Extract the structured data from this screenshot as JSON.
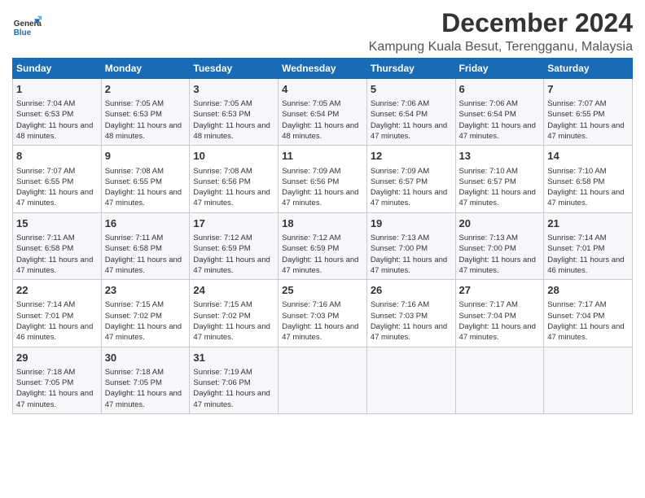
{
  "logo": {
    "line1": "General",
    "line2": "Blue"
  },
  "title": "December 2024",
  "subtitle": "Kampung Kuala Besut, Terengganu, Malaysia",
  "days_of_week": [
    "Sunday",
    "Monday",
    "Tuesday",
    "Wednesday",
    "Thursday",
    "Friday",
    "Saturday"
  ],
  "weeks": [
    [
      {
        "day": 1,
        "sunrise": "7:04 AM",
        "sunset": "6:53 PM",
        "daylight": "11 hours and 48 minutes."
      },
      {
        "day": 2,
        "sunrise": "7:05 AM",
        "sunset": "6:53 PM",
        "daylight": "11 hours and 48 minutes."
      },
      {
        "day": 3,
        "sunrise": "7:05 AM",
        "sunset": "6:53 PM",
        "daylight": "11 hours and 48 minutes."
      },
      {
        "day": 4,
        "sunrise": "7:05 AM",
        "sunset": "6:54 PM",
        "daylight": "11 hours and 48 minutes."
      },
      {
        "day": 5,
        "sunrise": "7:06 AM",
        "sunset": "6:54 PM",
        "daylight": "11 hours and 47 minutes."
      },
      {
        "day": 6,
        "sunrise": "7:06 AM",
        "sunset": "6:54 PM",
        "daylight": "11 hours and 47 minutes."
      },
      {
        "day": 7,
        "sunrise": "7:07 AM",
        "sunset": "6:55 PM",
        "daylight": "11 hours and 47 minutes."
      }
    ],
    [
      {
        "day": 8,
        "sunrise": "7:07 AM",
        "sunset": "6:55 PM",
        "daylight": "11 hours and 47 minutes."
      },
      {
        "day": 9,
        "sunrise": "7:08 AM",
        "sunset": "6:55 PM",
        "daylight": "11 hours and 47 minutes."
      },
      {
        "day": 10,
        "sunrise": "7:08 AM",
        "sunset": "6:56 PM",
        "daylight": "11 hours and 47 minutes."
      },
      {
        "day": 11,
        "sunrise": "7:09 AM",
        "sunset": "6:56 PM",
        "daylight": "11 hours and 47 minutes."
      },
      {
        "day": 12,
        "sunrise": "7:09 AM",
        "sunset": "6:57 PM",
        "daylight": "11 hours and 47 minutes."
      },
      {
        "day": 13,
        "sunrise": "7:10 AM",
        "sunset": "6:57 PM",
        "daylight": "11 hours and 47 minutes."
      },
      {
        "day": 14,
        "sunrise": "7:10 AM",
        "sunset": "6:58 PM",
        "daylight": "11 hours and 47 minutes."
      }
    ],
    [
      {
        "day": 15,
        "sunrise": "7:11 AM",
        "sunset": "6:58 PM",
        "daylight": "11 hours and 47 minutes."
      },
      {
        "day": 16,
        "sunrise": "7:11 AM",
        "sunset": "6:58 PM",
        "daylight": "11 hours and 47 minutes."
      },
      {
        "day": 17,
        "sunrise": "7:12 AM",
        "sunset": "6:59 PM",
        "daylight": "11 hours and 47 minutes."
      },
      {
        "day": 18,
        "sunrise": "7:12 AM",
        "sunset": "6:59 PM",
        "daylight": "11 hours and 47 minutes."
      },
      {
        "day": 19,
        "sunrise": "7:13 AM",
        "sunset": "7:00 PM",
        "daylight": "11 hours and 47 minutes."
      },
      {
        "day": 20,
        "sunrise": "7:13 AM",
        "sunset": "7:00 PM",
        "daylight": "11 hours and 47 minutes."
      },
      {
        "day": 21,
        "sunrise": "7:14 AM",
        "sunset": "7:01 PM",
        "daylight": "11 hours and 46 minutes."
      }
    ],
    [
      {
        "day": 22,
        "sunrise": "7:14 AM",
        "sunset": "7:01 PM",
        "daylight": "11 hours and 46 minutes."
      },
      {
        "day": 23,
        "sunrise": "7:15 AM",
        "sunset": "7:02 PM",
        "daylight": "11 hours and 47 minutes."
      },
      {
        "day": 24,
        "sunrise": "7:15 AM",
        "sunset": "7:02 PM",
        "daylight": "11 hours and 47 minutes."
      },
      {
        "day": 25,
        "sunrise": "7:16 AM",
        "sunset": "7:03 PM",
        "daylight": "11 hours and 47 minutes."
      },
      {
        "day": 26,
        "sunrise": "7:16 AM",
        "sunset": "7:03 PM",
        "daylight": "11 hours and 47 minutes."
      },
      {
        "day": 27,
        "sunrise": "7:17 AM",
        "sunset": "7:04 PM",
        "daylight": "11 hours and 47 minutes."
      },
      {
        "day": 28,
        "sunrise": "7:17 AM",
        "sunset": "7:04 PM",
        "daylight": "11 hours and 47 minutes."
      }
    ],
    [
      {
        "day": 29,
        "sunrise": "7:18 AM",
        "sunset": "7:05 PM",
        "daylight": "11 hours and 47 minutes."
      },
      {
        "day": 30,
        "sunrise": "7:18 AM",
        "sunset": "7:05 PM",
        "daylight": "11 hours and 47 minutes."
      },
      {
        "day": 31,
        "sunrise": "7:19 AM",
        "sunset": "7:06 PM",
        "daylight": "11 hours and 47 minutes."
      },
      null,
      null,
      null,
      null
    ]
  ]
}
